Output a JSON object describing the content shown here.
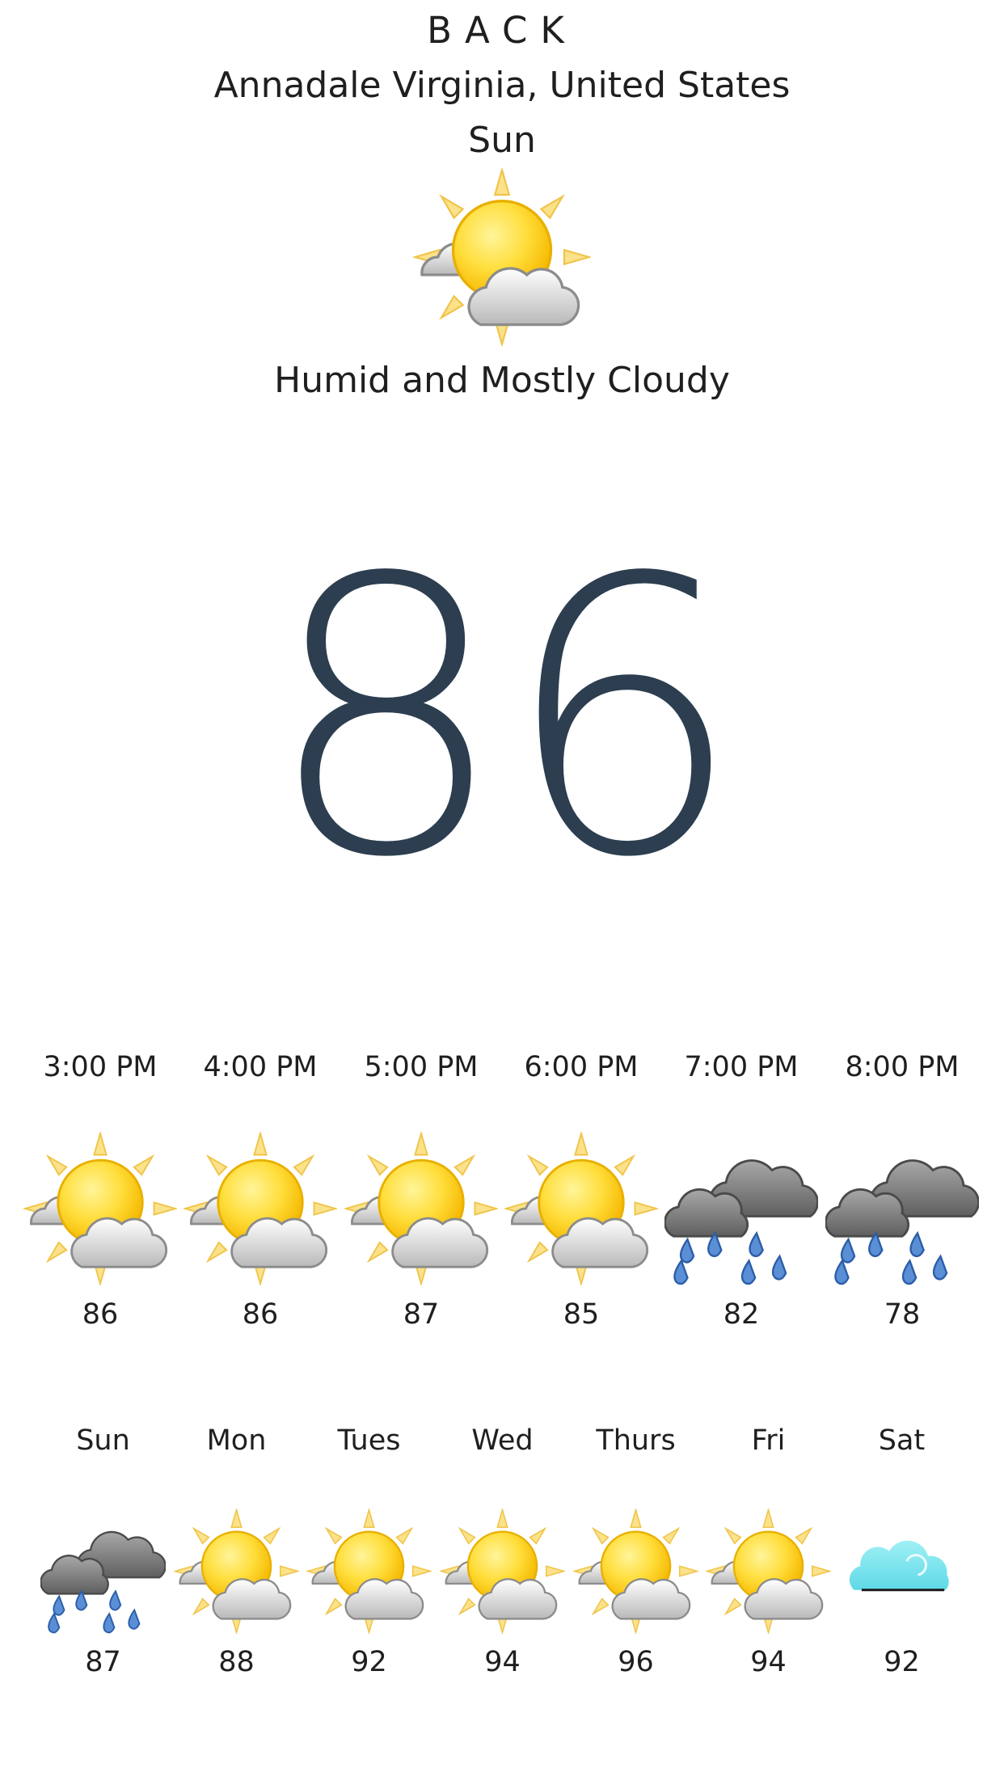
{
  "header": {
    "back_label": "BACK",
    "location": "Annadale Virginia, United States",
    "day": "Sun",
    "icon": "sun-cloud-icon",
    "condition": "Humid and Mostly Cloudy"
  },
  "current": {
    "temperature": "86",
    "color": "#2c3e50"
  },
  "hourly": [
    {
      "time": "3:00 PM",
      "temp": "86",
      "icon": "sun-cloud-icon"
    },
    {
      "time": "4:00 PM",
      "temp": "86",
      "icon": "sun-cloud-icon"
    },
    {
      "time": "5:00 PM",
      "temp": "87",
      "icon": "sun-cloud-icon"
    },
    {
      "time": "6:00 PM",
      "temp": "85",
      "icon": "sun-cloud-icon"
    },
    {
      "time": "7:00 PM",
      "temp": "82",
      "icon": "rain-cloud-icon"
    },
    {
      "time": "8:00 PM",
      "temp": "78",
      "icon": "rain-cloud-icon"
    }
  ],
  "daily": [
    {
      "day": "Sun",
      "temp": "87",
      "icon": "rain-cloud-icon"
    },
    {
      "day": "Mon",
      "temp": "88",
      "icon": "sun-cloud-icon"
    },
    {
      "day": "Tues",
      "temp": "92",
      "icon": "sun-cloud-icon"
    },
    {
      "day": "Wed",
      "temp": "94",
      "icon": "sun-cloud-icon"
    },
    {
      "day": "Thurs",
      "temp": "96",
      "icon": "sun-cloud-icon"
    },
    {
      "day": "Fri",
      "temp": "94",
      "icon": "sun-cloud-icon"
    },
    {
      "day": "Sat",
      "temp": "92",
      "icon": "cloud-icon"
    }
  ]
}
